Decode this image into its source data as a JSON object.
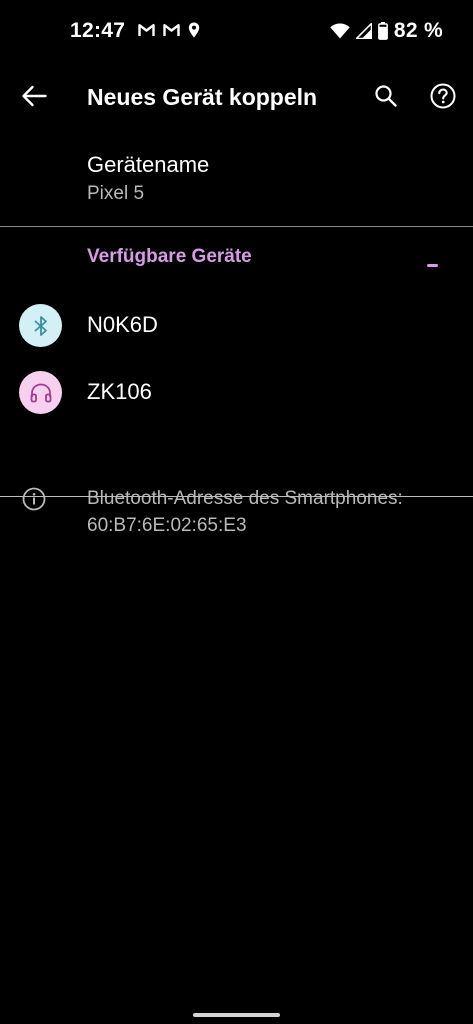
{
  "status_bar": {
    "time": "12:47",
    "battery_percent": "82 %",
    "icons": [
      "gmail-icon",
      "gmail-icon",
      "location-icon",
      "wifi-icon",
      "signal-icon",
      "battery-icon"
    ]
  },
  "app_bar": {
    "title": "Neues Gerät koppeln",
    "icons": [
      "back-arrow-icon",
      "search-icon",
      "help-icon"
    ]
  },
  "device_name": {
    "title": "Gerätename",
    "value": "Pixel 5"
  },
  "available_devices": {
    "header": "Verfügbare Geräte",
    "accent_color": "#d99be8",
    "items": [
      {
        "label": "N0K6D",
        "icon": "bluetooth-icon",
        "avatar_color": "#d3f0f7"
      },
      {
        "label": "ZK106",
        "icon": "headset-icon",
        "avatar_color": "#f7d0ef"
      }
    ]
  },
  "info": {
    "icon": "info-icon",
    "text": "Bluetooth-Adresse des Smartphones: 60:B7:6E:02:65:E3"
  }
}
